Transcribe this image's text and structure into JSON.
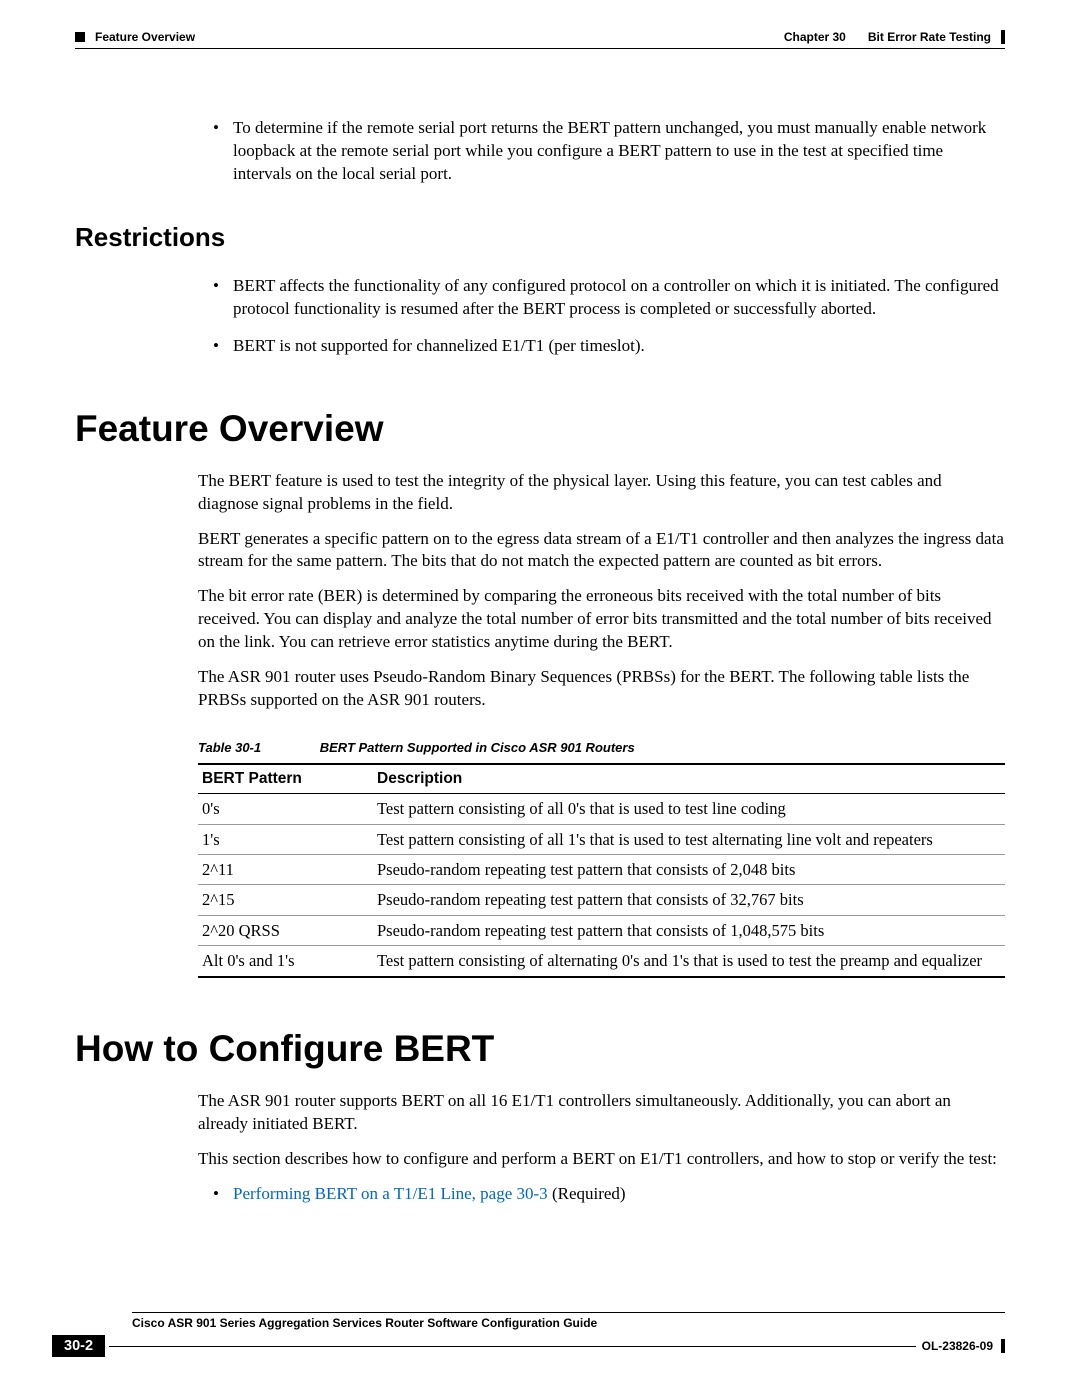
{
  "header": {
    "section": "Feature Overview",
    "chapter": "Chapter 30",
    "title": "Bit Error Rate Testing"
  },
  "intro_bullet": "To determine if the remote serial port returns the BERT pattern unchanged, you must manually enable network loopback at the remote serial port while you configure a BERT pattern to use in the test at specified time intervals on the local serial port.",
  "restrictions": {
    "heading": "Restrictions",
    "bullets": [
      "BERT affects the functionality of any configured protocol on a controller on which it is initiated. The configured protocol functionality is resumed after the BERT process is completed or successfully aborted.",
      "BERT is not supported for channelized E1/T1 (per timeslot)."
    ]
  },
  "feature_overview": {
    "heading": "Feature Overview",
    "paras": [
      "The BERT feature is used to test the integrity of the physical layer. Using this feature, you can test cables and diagnose signal problems in the field.",
      "BERT generates a specific pattern on to the egress data stream of a E1/T1 controller and then analyzes the ingress data stream for the same pattern. The bits that do not match the expected pattern are counted as bit errors.",
      "The bit error rate (BER) is determined by comparing the erroneous bits received with the total number of bits received. You can display and analyze the total number of error bits transmitted and the total number of bits received on the link. You can retrieve error statistics anytime during the BERT.",
      "The ASR 901 router uses Pseudo-Random Binary Sequences (PRBSs) for the BERT. The following table lists the PRBSs supported on the ASR 901 routers."
    ]
  },
  "table": {
    "label": "Table 30-1",
    "title": "BERT Pattern Supported in Cisco ASR 901 Routers",
    "headers": [
      "BERT Pattern",
      "Description"
    ],
    "rows": [
      [
        "0's",
        "Test pattern consisting of all 0's that is used to test line coding"
      ],
      [
        "1's",
        "Test pattern consisting of all 1's that is used to test alternating line volt and repeaters"
      ],
      [
        "2^11",
        "Pseudo-random repeating test pattern that consists of 2,048 bits"
      ],
      [
        "2^15",
        "Pseudo-random repeating test pattern that consists of 32,767 bits"
      ],
      [
        "2^20 QRSS",
        "Pseudo-random repeating test pattern that consists of 1,048,575 bits"
      ],
      [
        "Alt 0's and 1's",
        "Test pattern consisting of alternating 0's and 1's that is used to test the preamp and equalizer"
      ]
    ]
  },
  "how_to": {
    "heading": "How to Configure BERT",
    "paras": [
      "The ASR 901 router supports BERT on all 16 E1/T1 controllers simultaneously. Additionally, you can abort an already initiated BERT.",
      "This section describes how to configure and perform a BERT on E1/T1 controllers, and how to stop or verify the test:"
    ],
    "bullet_link": "Performing BERT on a T1/E1 Line, page 30-3",
    "bullet_suffix": " (Required)"
  },
  "footer": {
    "guide": "Cisco ASR 901 Series Aggregation Services Router Software Configuration Guide",
    "page": "30-2",
    "docid": "OL-23826-09"
  }
}
